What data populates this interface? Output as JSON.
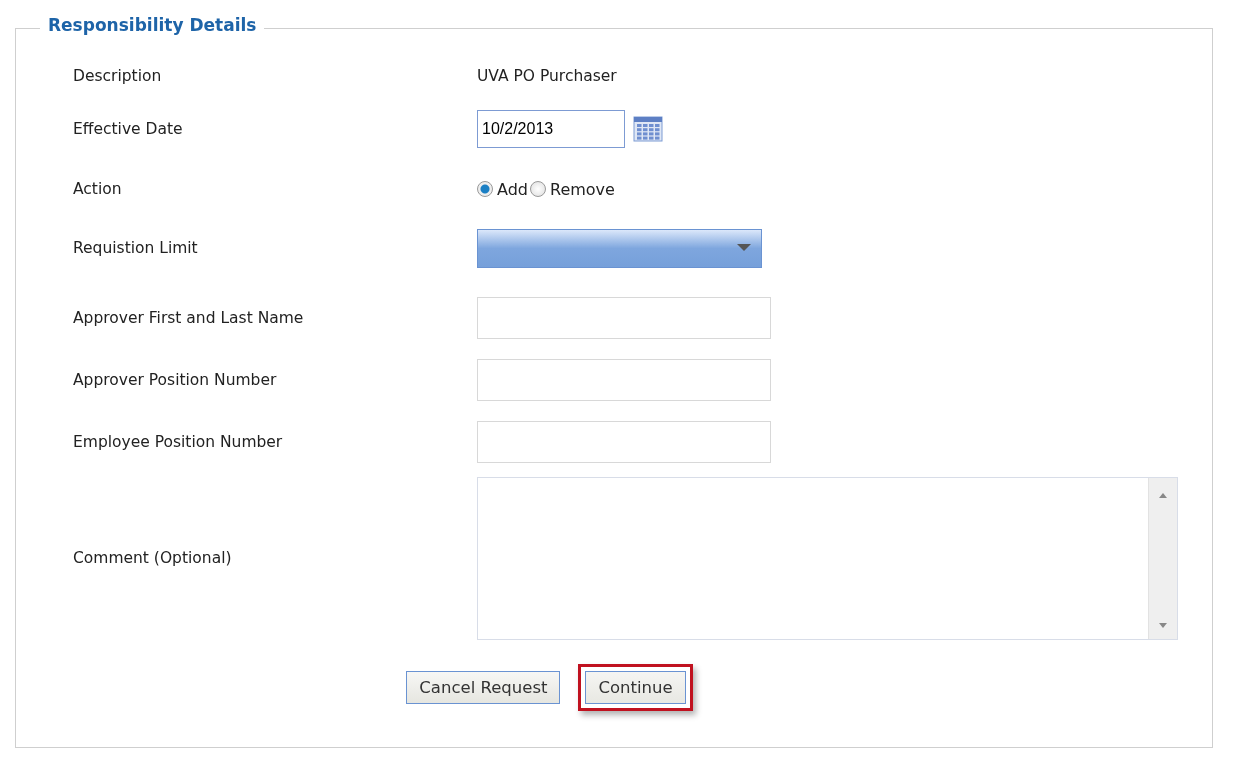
{
  "section": {
    "title": "Responsibility Details"
  },
  "fields": [
    {
      "kind": "text",
      "label": "Description",
      "value": "UVA PO Purchaser"
    },
    {
      "kind": "date",
      "label": "Effective Date",
      "value": "10/2/2013"
    },
    {
      "kind": "radio",
      "label": "Action",
      "options": [
        {
          "label": "Add",
          "selected": true
        },
        {
          "label": "Remove",
          "selected": false
        }
      ]
    },
    {
      "kind": "select",
      "label": "Requistion Limit"
    },
    {
      "kind": "input",
      "label": "Approver First and Last Name"
    },
    {
      "kind": "input",
      "label": "Approver Position Number"
    },
    {
      "kind": "input",
      "label": "Employee Position Number"
    },
    {
      "kind": "textarea",
      "label": "Comment (Optional)"
    }
  ],
  "buttons": [
    {
      "label": "Cancel Request",
      "highlighted": false
    },
    {
      "label": "Continue",
      "highlighted": true
    }
  ]
}
